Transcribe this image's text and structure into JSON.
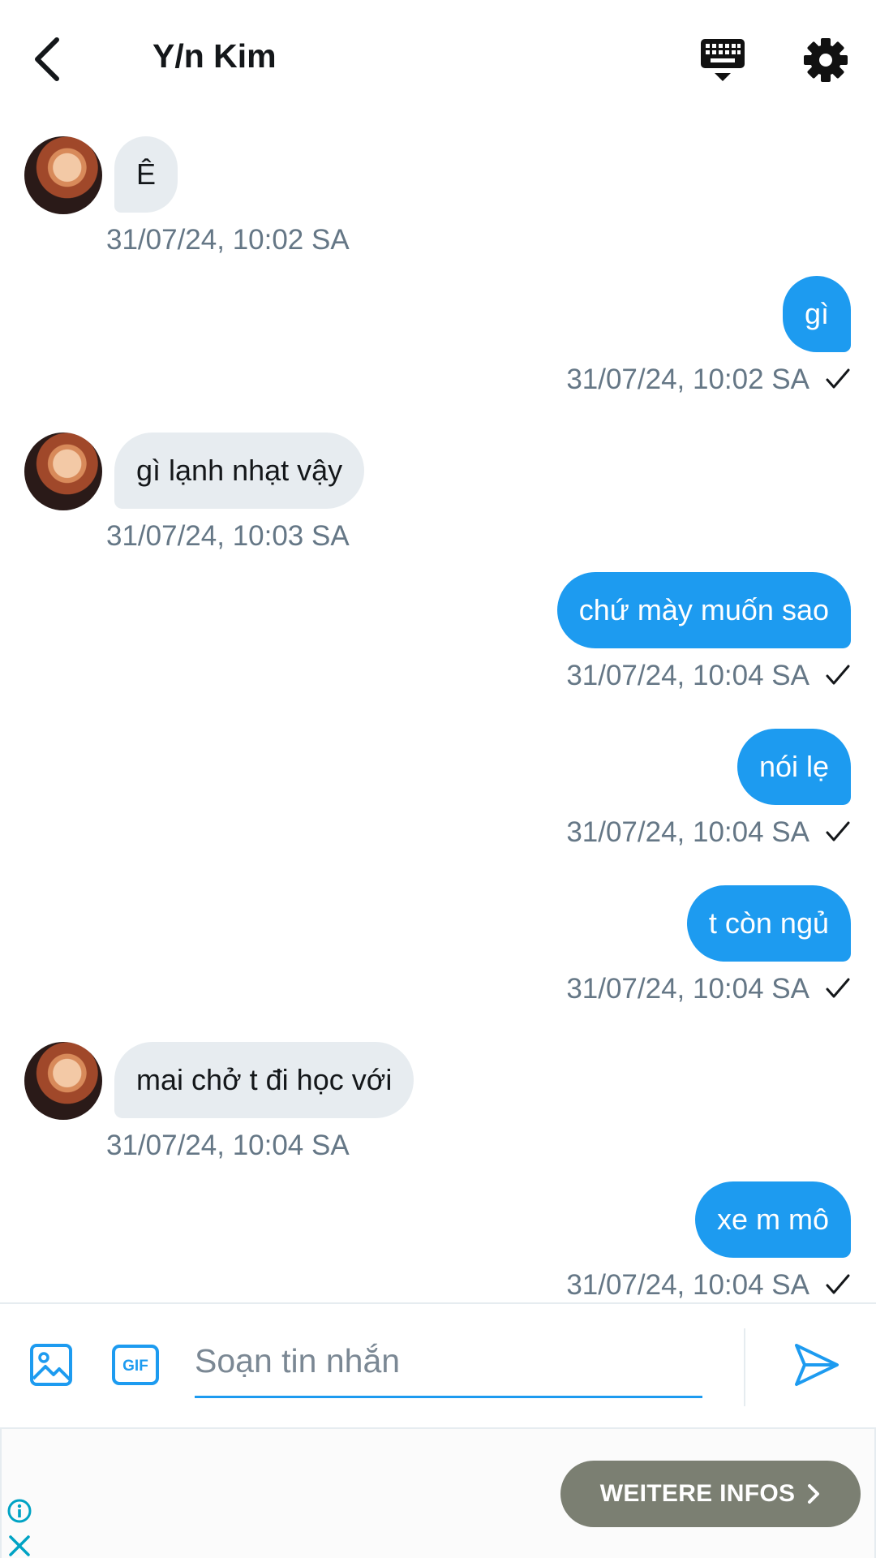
{
  "header": {
    "title": "Y/n Kim",
    "icons": {
      "back": "chevron-left-icon",
      "keyboard": "keyboard-icon",
      "settings": "gear-icon"
    }
  },
  "messages": [
    {
      "direction": "in",
      "text": "Ê",
      "time": "31/07/24, 10:02 SA"
    },
    {
      "direction": "out",
      "text": "gì",
      "time": "31/07/24, 10:02 SA",
      "status": "sent-check-icon"
    },
    {
      "direction": "in",
      "text": "gì lạnh nhạt vậy",
      "time": "31/07/24, 10:03 SA"
    },
    {
      "direction": "out",
      "text": "chứ mày muốn sao",
      "time": "31/07/24, 10:04 SA",
      "status": "sent-check-icon"
    },
    {
      "direction": "out",
      "text": "nói lẹ",
      "time": "31/07/24, 10:04 SA",
      "status": "sent-check-icon"
    },
    {
      "direction": "out",
      "text": "t còn ngủ",
      "time": "31/07/24, 10:04 SA",
      "status": "sent-check-icon"
    },
    {
      "direction": "in",
      "text": "mai chở t đi học với",
      "time": "31/07/24, 10:04 SA"
    },
    {
      "direction": "out",
      "text": "xe m mô",
      "time": "31/07/24, 10:04 SA",
      "status": "sent-check-icon"
    }
  ],
  "composer": {
    "placeholder": "Soạn tin nhắn",
    "value": "",
    "gif_label": "GIF",
    "icons": {
      "image": "image-icon",
      "gif": "gif-icon",
      "send": "send-icon"
    }
  },
  "ad": {
    "cta_label": "WEITERE INFOS",
    "icons": {
      "info": "info-icon",
      "close": "close-icon",
      "cta": "chevron-right-icon"
    }
  },
  "colors": {
    "accent": "#1d9bf0",
    "incoming_bubble": "#e7ecf0",
    "timestamp": "#657786",
    "ad_button": "#7b7f72"
  }
}
